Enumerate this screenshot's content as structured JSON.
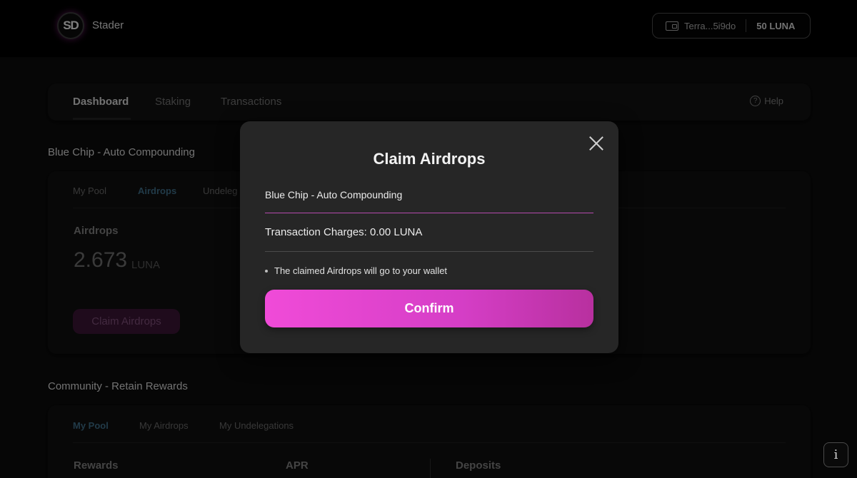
{
  "header": {
    "logo_text": "SD",
    "brand": "Stader",
    "wallet_address": "Terra...5i9do",
    "wallet_balance": "50 LUNA"
  },
  "nav": {
    "tabs": [
      {
        "label": "Dashboard",
        "active": true
      },
      {
        "label": "Staking",
        "active": false
      },
      {
        "label": "Transactions",
        "active": false
      }
    ],
    "help_label": "Help"
  },
  "blue_chip": {
    "title": "Blue Chip - Auto Compounding",
    "tabs": [
      "My Pool",
      "Airdrops",
      "Undeleg"
    ],
    "active_tab": "Airdrops",
    "stat_label": "Airdrops",
    "stat_value": "2.673",
    "stat_unit": "LUNA",
    "claim_label": "Claim Airdrops"
  },
  "community": {
    "title": "Community - Retain Rewards",
    "tabs": [
      "My Pool",
      "My Airdrops",
      "My Undelegations"
    ],
    "active_tab": "My Pool",
    "columns": [
      "Rewards",
      "APR",
      "Deposits"
    ]
  },
  "modal": {
    "title": "Claim Airdrops",
    "pool": "Blue Chip - Auto Compounding",
    "charges": "Transaction Charges: 0.00 LUNA",
    "note": "The claimed Airdrops will go to your wallet",
    "confirm_label": "Confirm"
  },
  "info_icon": "i",
  "colors": {
    "accent": "#e446d2",
    "active_tab": "#3d6a84",
    "background": "#0c0c0c"
  }
}
